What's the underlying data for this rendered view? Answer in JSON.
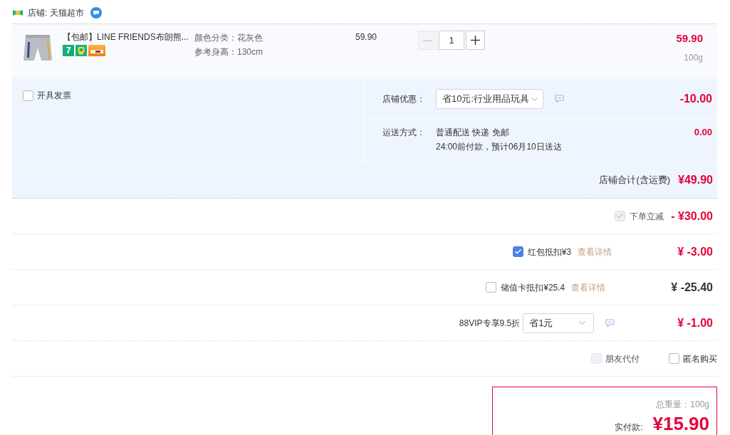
{
  "shop": {
    "label": "店铺: 天猫超市"
  },
  "item": {
    "title": "【包邮】LINE FRIENDS布朗熊...",
    "badges": [
      {
        "kind": "number",
        "label": "7"
      },
      {
        "kind": "tag"
      },
      {
        "kind": "card"
      }
    ],
    "sku": [
      "颜色分类：花灰色",
      "参考身高：130cm"
    ],
    "unit_price": "59.90",
    "quantity": {
      "value": "1",
      "minus_disabled": true,
      "plus_disabled": false
    },
    "subtotal": "59.90",
    "weight": "100g"
  },
  "invoice": {
    "label": "开具发票",
    "checked": false
  },
  "shop_discount": {
    "label": "店铺优惠：",
    "selected_option": "省10元:行业用品玩具",
    "amount": "-10.00"
  },
  "shipping": {
    "label": "运送方式：",
    "lines": [
      "普通配送 快递 免邮",
      "24:00前付款，预计06月10日送达"
    ],
    "amount": "0.00"
  },
  "shop_total": {
    "label": "店铺合计(含运费)",
    "amount": "¥49.90"
  },
  "adjustments": [
    {
      "kind": "discount",
      "label": "下单立减",
      "checked": true,
      "disabled": true,
      "amount": "- ¥30.00"
    },
    {
      "kind": "deduction",
      "label": "红包抵扣¥3",
      "link": "查看详情",
      "checked": true,
      "disabled": false,
      "amount": "¥ -3.00"
    },
    {
      "kind": "deduction",
      "label": "储值卡抵扣¥25.4",
      "link": "查看详情",
      "checked": false,
      "disabled": false,
      "amount": "¥ -25.40"
    },
    {
      "kind": "select",
      "label": "88VIP专享9.5折",
      "selected_option": "省1元",
      "amount": "¥ -1.00"
    }
  ],
  "options": [
    {
      "label": "朋友代付",
      "checked": false,
      "disabled": true
    },
    {
      "label": "匿名购买",
      "checked": false,
      "disabled": false
    }
  ],
  "summary": {
    "weight": "总重量：100g",
    "pay_label": "实付款:",
    "pay_amount": "¥15.90"
  }
}
